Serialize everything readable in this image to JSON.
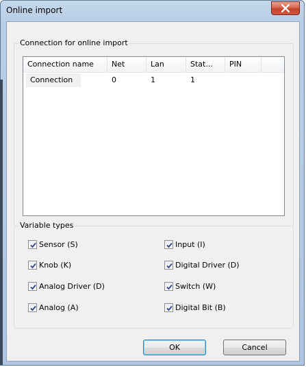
{
  "window": {
    "title": "Online import"
  },
  "connection_group": {
    "legend": "Connection for online import",
    "columns": [
      "Connection name",
      "Net",
      "Lan",
      "Stat...",
      "PIN"
    ],
    "rows": [
      [
        "Connection",
        "0",
        "1",
        "1",
        ""
      ]
    ]
  },
  "variable_group": {
    "legend": "Variable types",
    "items": [
      {
        "label": "Sensor (S)",
        "checked": true
      },
      {
        "label": "Input (I)",
        "checked": true
      },
      {
        "label": "Knob (K)",
        "checked": true
      },
      {
        "label": "Digital Driver (D)",
        "checked": true
      },
      {
        "label": "Analog Driver (D)",
        "checked": true
      },
      {
        "label": "Switch (W)",
        "checked": true
      },
      {
        "label": "Analog (A)",
        "checked": true
      },
      {
        "label": "Digital Bit (B)",
        "checked": true
      }
    ]
  },
  "buttons": {
    "ok": "OK",
    "cancel": "Cancel"
  },
  "colors": {
    "title_gradient": "#b9cee6",
    "close_button": "#c4432b",
    "dialog_bg": "#f0f0f0",
    "check_mark": "#3a4d8f"
  },
  "icons": {
    "close": "close-icon",
    "check": "check-icon"
  }
}
